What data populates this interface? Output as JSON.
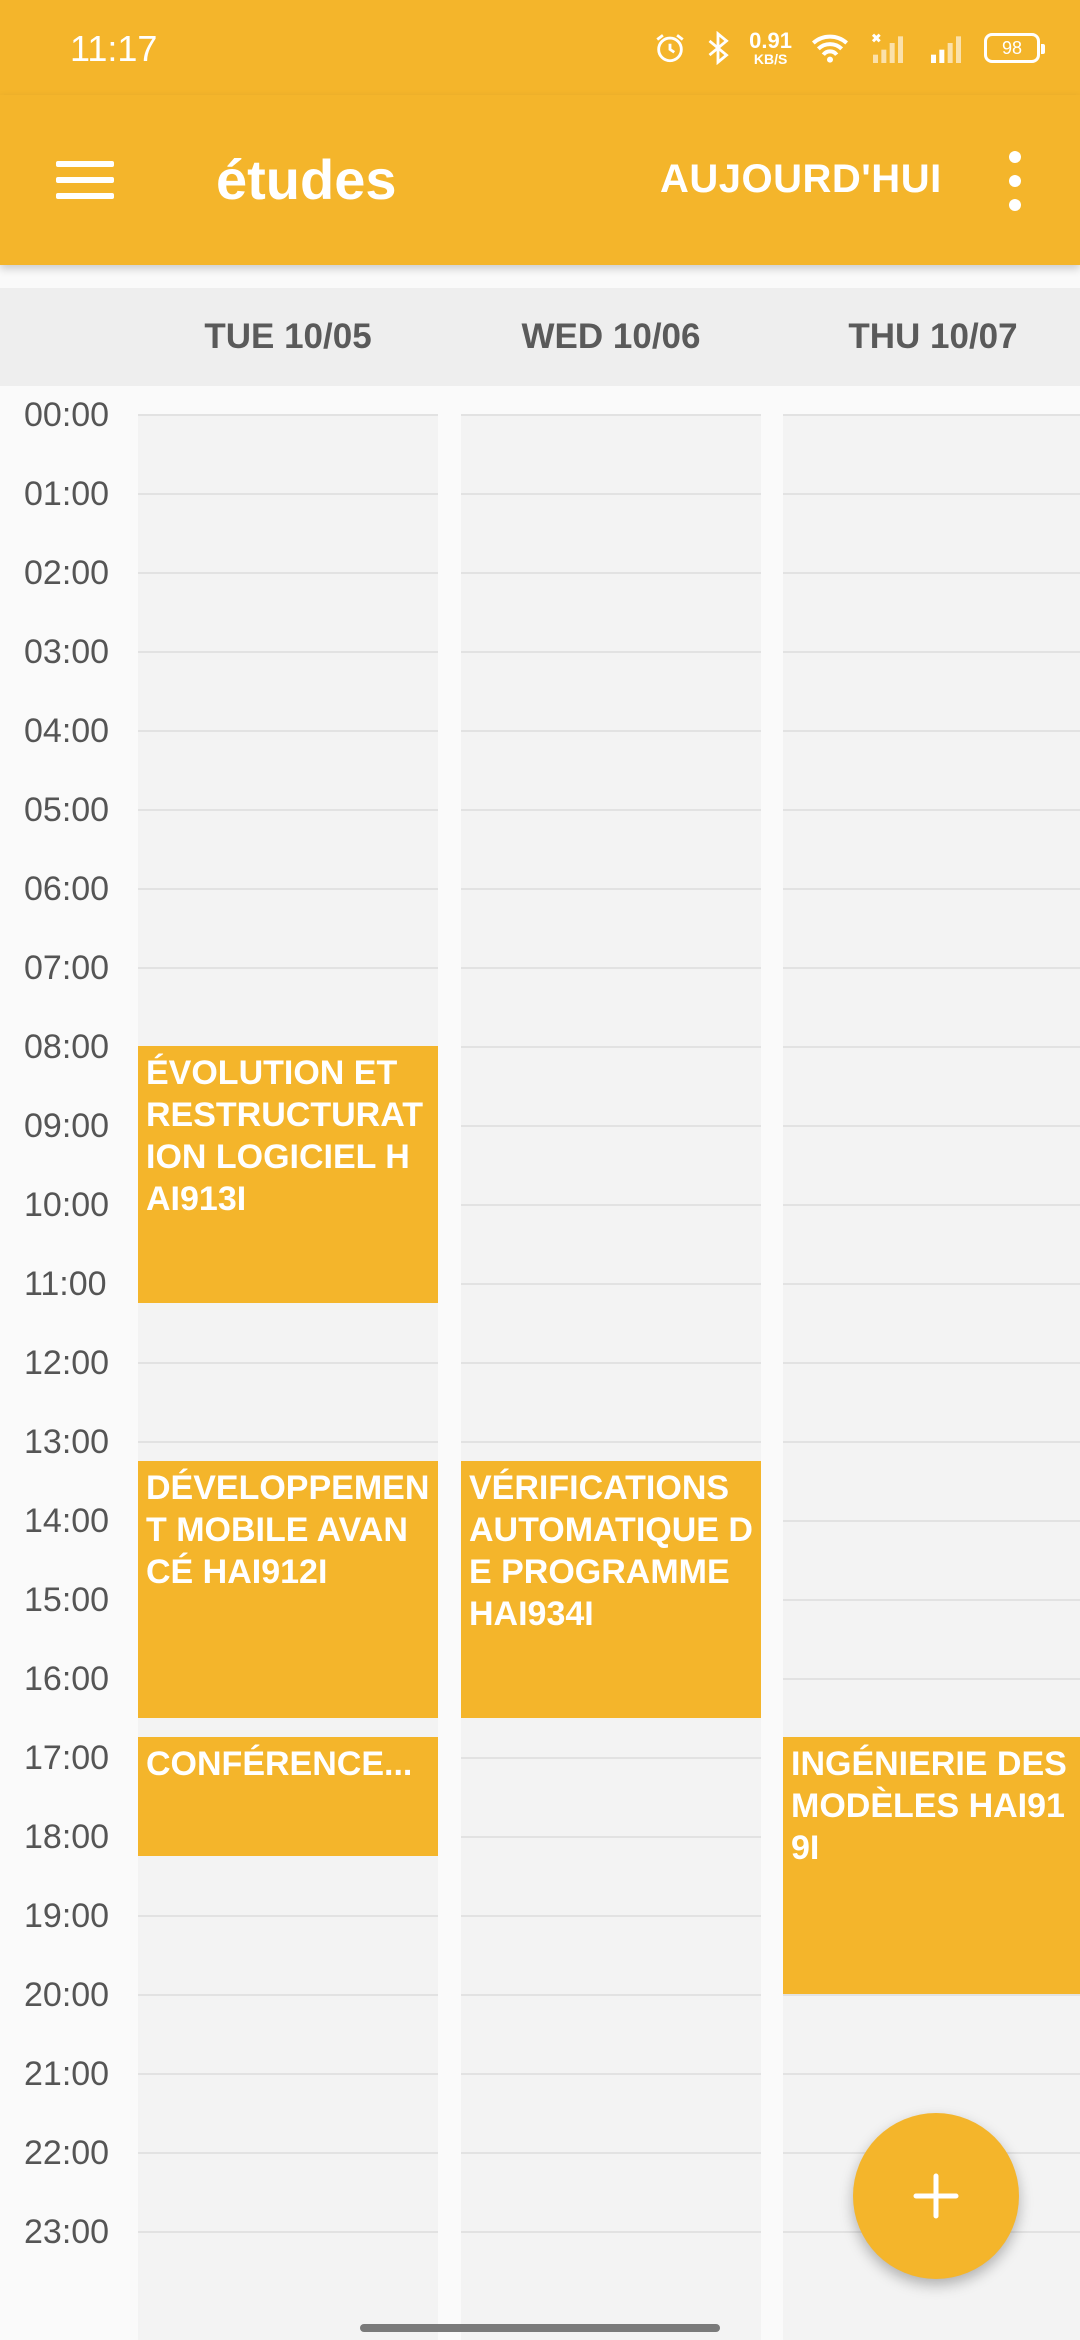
{
  "status_bar": {
    "time": "11:17",
    "net_speed": "0.91",
    "net_unit": "KB/S",
    "battery": "98",
    "icons": [
      "alarm-icon",
      "bluetooth-icon",
      "wifi-icon",
      "signal-icon",
      "signal-icon"
    ]
  },
  "app_bar": {
    "title": "études",
    "today_label": "AUJOURD'HUI",
    "color": "#f4b52b"
  },
  "days": [
    {
      "label": "TUE 10/05"
    },
    {
      "label": "WED 10/06"
    },
    {
      "label": "THU 10/07"
    }
  ],
  "hours": [
    "00:00",
    "01:00",
    "02:00",
    "03:00",
    "04:00",
    "05:00",
    "06:00",
    "07:00",
    "08:00",
    "09:00",
    "10:00",
    "11:00",
    "12:00",
    "13:00",
    "14:00",
    "15:00",
    "16:00",
    "17:00",
    "18:00",
    "19:00",
    "20:00",
    "21:00",
    "22:00",
    "23:00"
  ],
  "events": [
    {
      "day": 0,
      "start": 8.0,
      "end": 11.25,
      "title": "ÉVOLUTION ET RESTRUCTURATION LOGICIEL HAI913I"
    },
    {
      "day": 0,
      "start": 13.25,
      "end": 16.5,
      "title": "DÉVELOPPEMENT MOBILE AVANCÉ HAI912I"
    },
    {
      "day": 0,
      "start": 16.75,
      "end": 18.25,
      "title": "CONFÉRENCE..."
    },
    {
      "day": 1,
      "start": 13.25,
      "end": 16.5,
      "title": "VÉRIFICATIONS AUTOMATIQUE DE PROGRAMME HAI934I"
    },
    {
      "day": 2,
      "start": 16.75,
      "end": 20.0,
      "title": "INGÉNIERIE DES MODÈLES HAI919I"
    }
  ],
  "fab": {
    "icon": "plus-icon"
  }
}
